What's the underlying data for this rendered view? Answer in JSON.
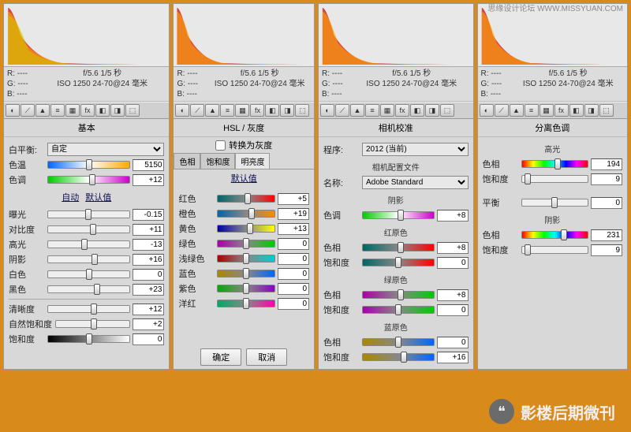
{
  "watermark_top": "思缘设计论坛  WWW.MISSYUAN.COM",
  "watermark_bottom": "影楼后期微刊",
  "exposure_info": {
    "line1": "f/5.6  1/5 秒",
    "line2": "ISO 1250  24-70@24 毫米"
  },
  "rgb": {
    "r": "R:  ----",
    "g": "G:  ----",
    "b": "B:  ----"
  },
  "panel1": {
    "title": "基本",
    "wb_label": "白平衡:",
    "wb_value": "自定",
    "link_auto": "自动",
    "link_default": "默认值",
    "sliders": {
      "temp": {
        "label": "色温",
        "value": "5150"
      },
      "tint": {
        "label": "色调",
        "value": "+12"
      },
      "exp": {
        "label": "曝光",
        "value": "-0.15"
      },
      "contr": {
        "label": "对比度",
        "value": "+11"
      },
      "high": {
        "label": "高光",
        "value": "-13"
      },
      "shadow": {
        "label": "阴影",
        "value": "+16"
      },
      "white": {
        "label": "白色",
        "value": "0"
      },
      "black": {
        "label": "黑色",
        "value": "+23"
      },
      "clar": {
        "label": "清晰度",
        "value": "+12"
      },
      "vib": {
        "label": "自然饱和度",
        "value": "+2"
      },
      "sat": {
        "label": "饱和度",
        "value": "0"
      }
    }
  },
  "panel2": {
    "tab_bar": "HSL / 灰度",
    "check": "转换为灰度",
    "tabs": {
      "a": "色相",
      "b": "饱和度",
      "c": "明亮度"
    },
    "link_default": "默认值",
    "red": {
      "label": "红色",
      "value": "+5"
    },
    "orange": {
      "label": "橙色",
      "value": "+19"
    },
    "yellow": {
      "label": "黄色",
      "value": "+13"
    },
    "green": {
      "label": "绿色",
      "value": "0"
    },
    "aqua": {
      "label": "浅绿色",
      "value": "0"
    },
    "blue": {
      "label": "蓝色",
      "value": "0"
    },
    "purple": {
      "label": "紫色",
      "value": "0"
    },
    "magenta": {
      "label": "洋红",
      "value": "0"
    },
    "btn_ok": "确定",
    "btn_cancel": "取消"
  },
  "panel3": {
    "title": "相机校准",
    "process_label": "程序:",
    "process_value": "2012 (当前)",
    "profile_head": "相机配置文件",
    "profile_label": "名称:",
    "profile_value": "Adobe Standard",
    "shadow_head": "阴影",
    "shadow_tint": {
      "label": "色调",
      "value": "+8"
    },
    "red_head": "红原色",
    "red_hue": {
      "label": "色相",
      "value": "+8"
    },
    "red_sat": {
      "label": "饱和度",
      "value": "0"
    },
    "green_head": "绿原色",
    "green_hue": {
      "label": "色相",
      "value": "+8"
    },
    "green_sat": {
      "label": "饱和度",
      "value": "0"
    },
    "blue_head": "蓝原色",
    "blue_hue": {
      "label": "色相",
      "value": "0"
    },
    "blue_sat": {
      "label": "饱和度",
      "value": "+16"
    }
  },
  "panel4": {
    "title": "分离色调",
    "hi_head": "高光",
    "hi_hue": {
      "label": "色相",
      "value": "194"
    },
    "hi_sat": {
      "label": "饱和度",
      "value": "9"
    },
    "bal": {
      "label": "平衡",
      "value": "0"
    },
    "sh_head": "阴影",
    "sh_hue": {
      "label": "色相",
      "value": "231"
    },
    "sh_sat": {
      "label": "饱和度",
      "value": "9"
    }
  }
}
